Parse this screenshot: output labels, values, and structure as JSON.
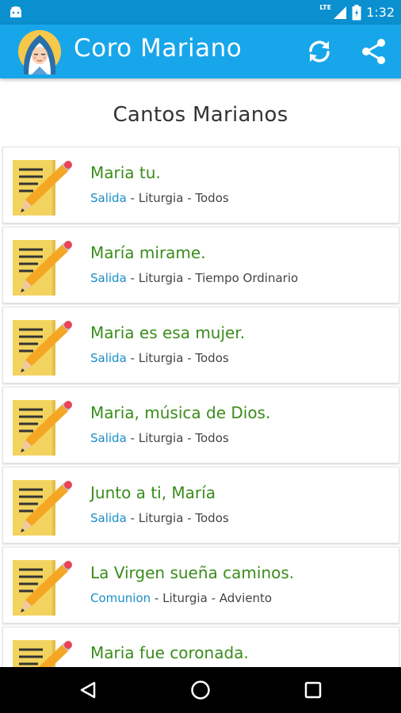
{
  "status_bar": {
    "network": "LTE",
    "time": "1:32"
  },
  "app_bar": {
    "title": "Coro Mariano",
    "icons": [
      "virgin-mary-logo-icon",
      "sync-icon",
      "share-icon"
    ]
  },
  "section_title": "Cantos Marianos",
  "songs": [
    {
      "title": "Maria tu.",
      "category": "Salida",
      "type": "Liturgia",
      "season": "Todos"
    },
    {
      "title": "María mirame.",
      "category": "Salida",
      "type": "Liturgia",
      "season": "Tiempo Ordinario"
    },
    {
      "title": "Maria es esa mujer.",
      "category": "Salida",
      "type": "Liturgia",
      "season": "Todos"
    },
    {
      "title": "Maria, música de Dios.",
      "category": "Salida",
      "type": "Liturgia",
      "season": "Todos"
    },
    {
      "title": "Junto a ti, María",
      "category": "Salida",
      "type": "Liturgia",
      "season": "Todos"
    },
    {
      "title": "La Virgen sueña caminos.",
      "category": "Comunion",
      "type": "Liturgia",
      "season": "Adviento"
    },
    {
      "title": "Maria fue coronada.",
      "category": "",
      "type": "",
      "season": ""
    }
  ],
  "separator": " - ",
  "colors": {
    "status_bar": "#0a8fcf",
    "app_bar": "#18a6ea",
    "song_title": "#3a8c1b",
    "category": "#1a8ec9",
    "nav_bar": "#000000"
  },
  "nav_bar": {
    "icons": [
      "back-icon",
      "home-icon",
      "recents-icon"
    ]
  }
}
